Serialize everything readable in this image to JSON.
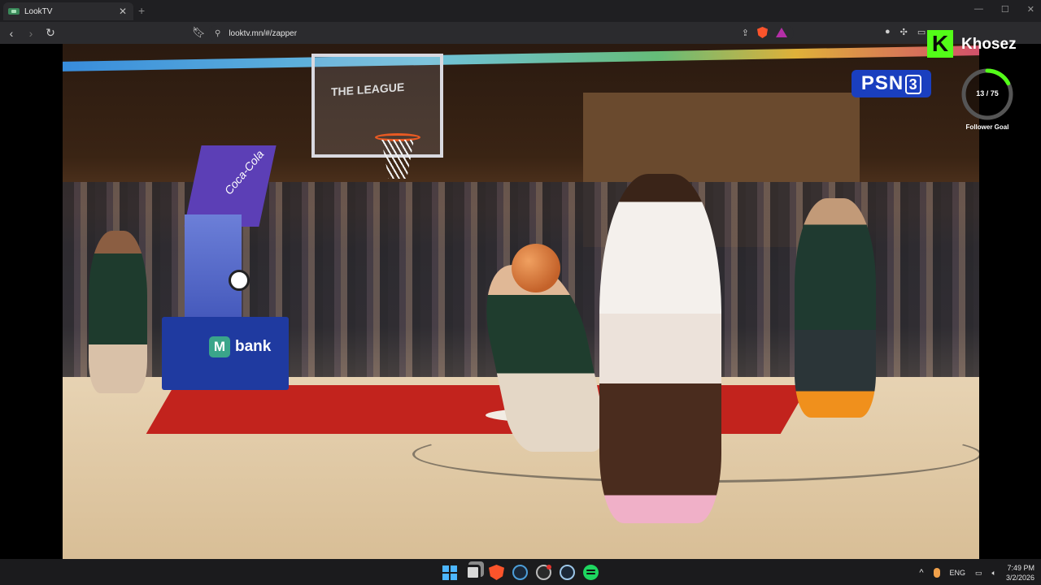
{
  "browser": {
    "tab": {
      "title": "LookTV"
    },
    "url": "looktv.mn/#/zapper",
    "window_controls": [
      "—",
      "☐",
      "✕"
    ]
  },
  "video": {
    "channel_logo": {
      "text": "PSN",
      "number": "3"
    },
    "backboard_text": "THE LEAGUE",
    "sponsor_pad": "Coca-Cola",
    "sponsor_board": "bank",
    "sponsor_board_mark": "M"
  },
  "overlay": {
    "kick_letter": "K",
    "streamer": "Khosez",
    "follower_goal": {
      "current": 13,
      "target": 75,
      "text": "13 / 75",
      "label": "Follower Goal",
      "progress": 0.173
    },
    "colors": {
      "kick_green": "#53fc18",
      "ring_track": "#555555"
    }
  },
  "taskbar": {
    "apps": [
      "windows-start",
      "task-view",
      "brave",
      "steam",
      "obs",
      "steam",
      "spotify"
    ],
    "tray": {
      "language": "ENG",
      "time": "7:49 PM",
      "date": "3/2/2026"
    }
  }
}
